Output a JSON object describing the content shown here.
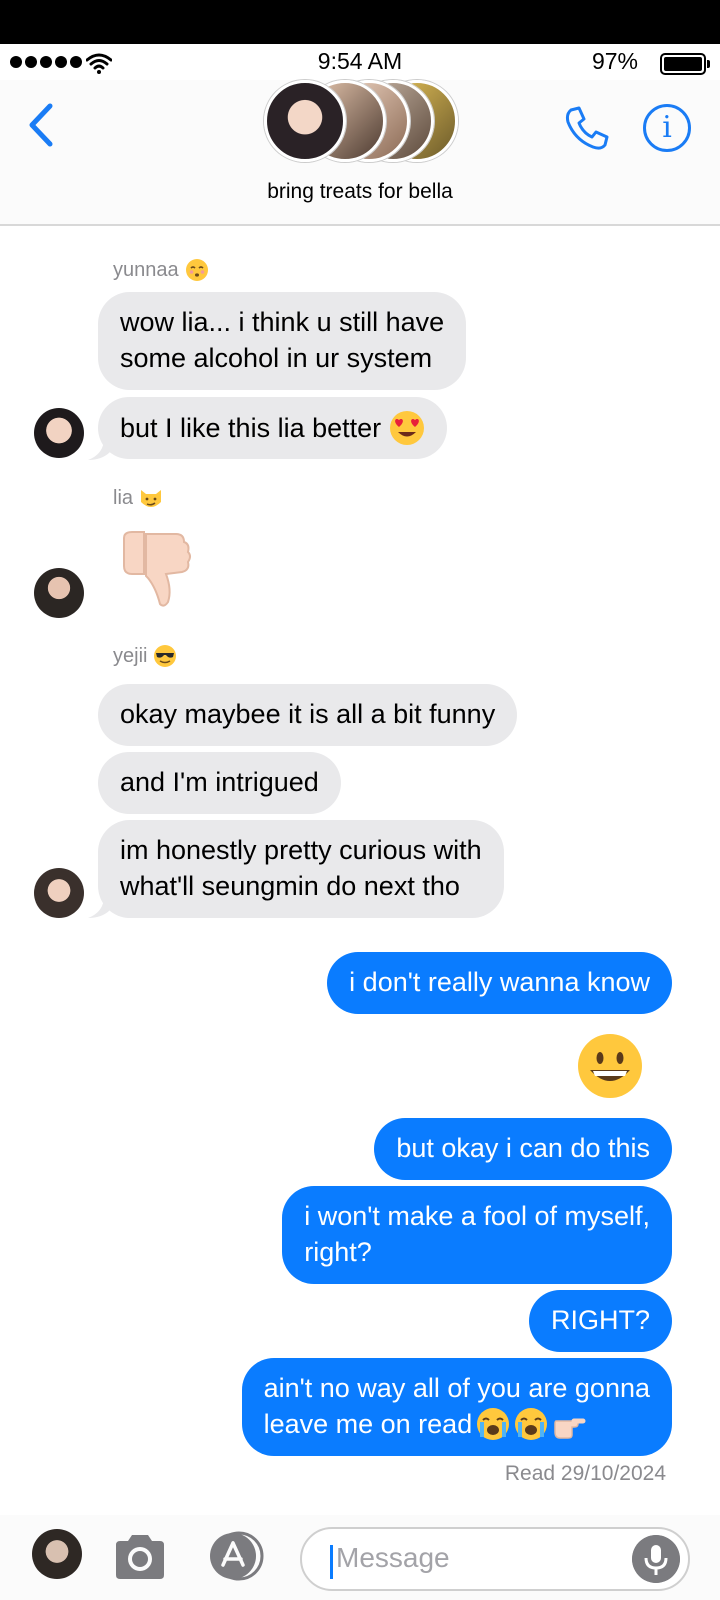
{
  "status_bar": {
    "time": "9:54 AM",
    "battery": "97%"
  },
  "header": {
    "title": "bring treats for bella"
  },
  "groups": [
    {
      "sender": "yunnaa",
      "messages": [
        "wow lia... i think u still have",
        "some alcohol in ur system",
        "but I like this lia better"
      ]
    },
    {
      "sender": "lia"
    },
    {
      "sender": "yejii",
      "messages": [
        "okay maybee it is all a bit funny",
        "and I'm intrigued",
        "im honestly pretty curious with",
        "what'll seungmin do next tho"
      ]
    }
  ],
  "outgoing": [
    "i don't really wanna know",
    "but okay i can do this",
    "i won't make a fool of myself,",
    "right?",
    "RIGHT?",
    "ain't no way all of you are gonna",
    "leave me on read"
  ],
  "read_receipt": "Read 29/10/2024",
  "compose": {
    "placeholder": "Message"
  },
  "colors": {
    "accent": "#0a7cff",
    "incoming_bubble": "#e9e9eb",
    "icon_blue": "#1a7cf5"
  },
  "icons": [
    "back-chevron-icon",
    "phone-icon",
    "info-icon",
    "camera-icon",
    "app-store-icon",
    "microphone-icon"
  ]
}
